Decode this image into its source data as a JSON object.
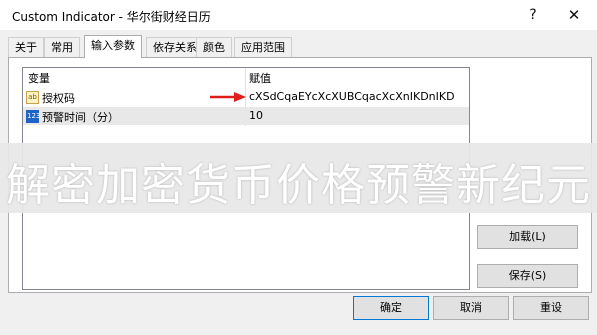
{
  "window": {
    "title": "Custom Indicator - 华尔街财经日历",
    "help_label": "?",
    "close_label": "✕"
  },
  "tabs": [
    {
      "label": "关于"
    },
    {
      "label": "常用"
    },
    {
      "label": "输入参数",
      "active": true
    },
    {
      "label": "依存关系"
    },
    {
      "label": "颜色"
    },
    {
      "label": "应用范围"
    }
  ],
  "grid": {
    "columns": [
      "变量",
      "赋值"
    ],
    "rows": [
      {
        "icon": "ab",
        "name": "授权码",
        "value": "cXSdCqaEYcXcXUBCqacXcXnIKDnIKD"
      },
      {
        "icon": "123",
        "name": "预警时间（分）",
        "value": "10"
      }
    ]
  },
  "banner": {
    "text": "解密加密货币价格预警新纪元"
  },
  "buttons": {
    "load": "加载(L)",
    "save": "保存(S)",
    "ok": "确定",
    "cancel": "取消",
    "reset": "重设"
  },
  "colors": {
    "accent": "#0078d7",
    "arrow": "#e21b1b"
  }
}
